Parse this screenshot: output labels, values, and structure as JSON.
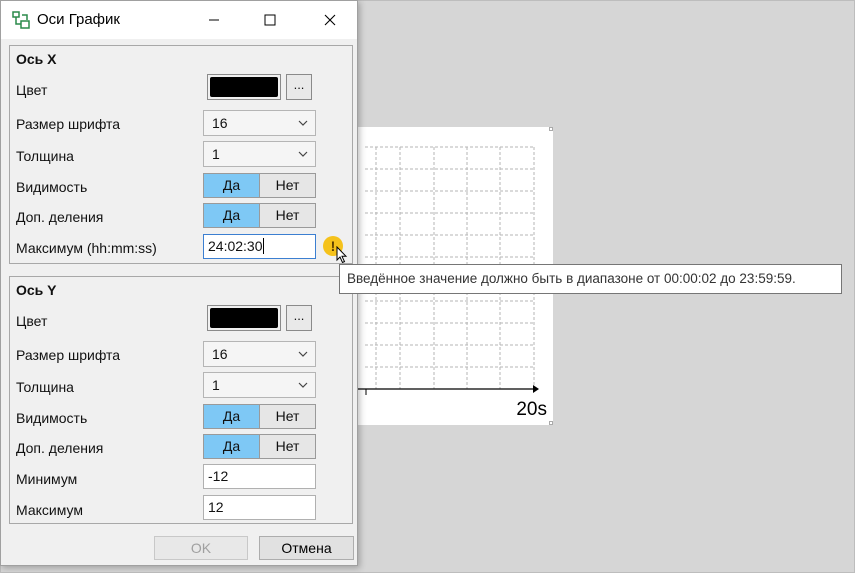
{
  "window": {
    "title": "Оси График"
  },
  "chart": {
    "x_tick_label": "20s"
  },
  "axis_x": {
    "title": "Ось X",
    "color_label": "Цвет",
    "color_value": "#000000",
    "color_button": "...",
    "font_size_label": "Размер шрифта",
    "font_size_value": "16",
    "thickness_label": "Толщина",
    "thickness_value": "1",
    "visibility_label": "Видимость",
    "visibility_yes": "Да",
    "visibility_no": "Нет",
    "visibility_selected": "Да",
    "minor_ticks_label": "Доп. деления",
    "minor_ticks_yes": "Да",
    "minor_ticks_no": "Нет",
    "minor_ticks_selected": "Да",
    "max_label": "Максимум (hh:mm:ss)",
    "max_value": "24:02:30"
  },
  "validation": {
    "icon": "warning-icon",
    "tooltip": "Введённое значение должно быть в диапазоне от 00:00:02 до 23:59:59."
  },
  "axis_y": {
    "title": "Ось Y",
    "color_label": "Цвет",
    "color_value": "#000000",
    "color_button": "...",
    "font_size_label": "Размер шрифта",
    "font_size_value": "16",
    "thickness_label": "Толщина",
    "thickness_value": "1",
    "visibility_label": "Видимость",
    "visibility_yes": "Да",
    "visibility_no": "Нет",
    "visibility_selected": "Да",
    "minor_ticks_label": "Доп. деления",
    "minor_ticks_yes": "Да",
    "minor_ticks_no": "Нет",
    "minor_ticks_selected": "Да",
    "min_label": "Минимум",
    "min_value": "-12",
    "max_label": "Максимум",
    "max_value": "12"
  },
  "buttons": {
    "ok": "OK",
    "cancel": "Отмена",
    "ok_enabled": false
  },
  "colors": {
    "toggle_selected": "#7ec8f5",
    "warning": "#f5c21b"
  }
}
